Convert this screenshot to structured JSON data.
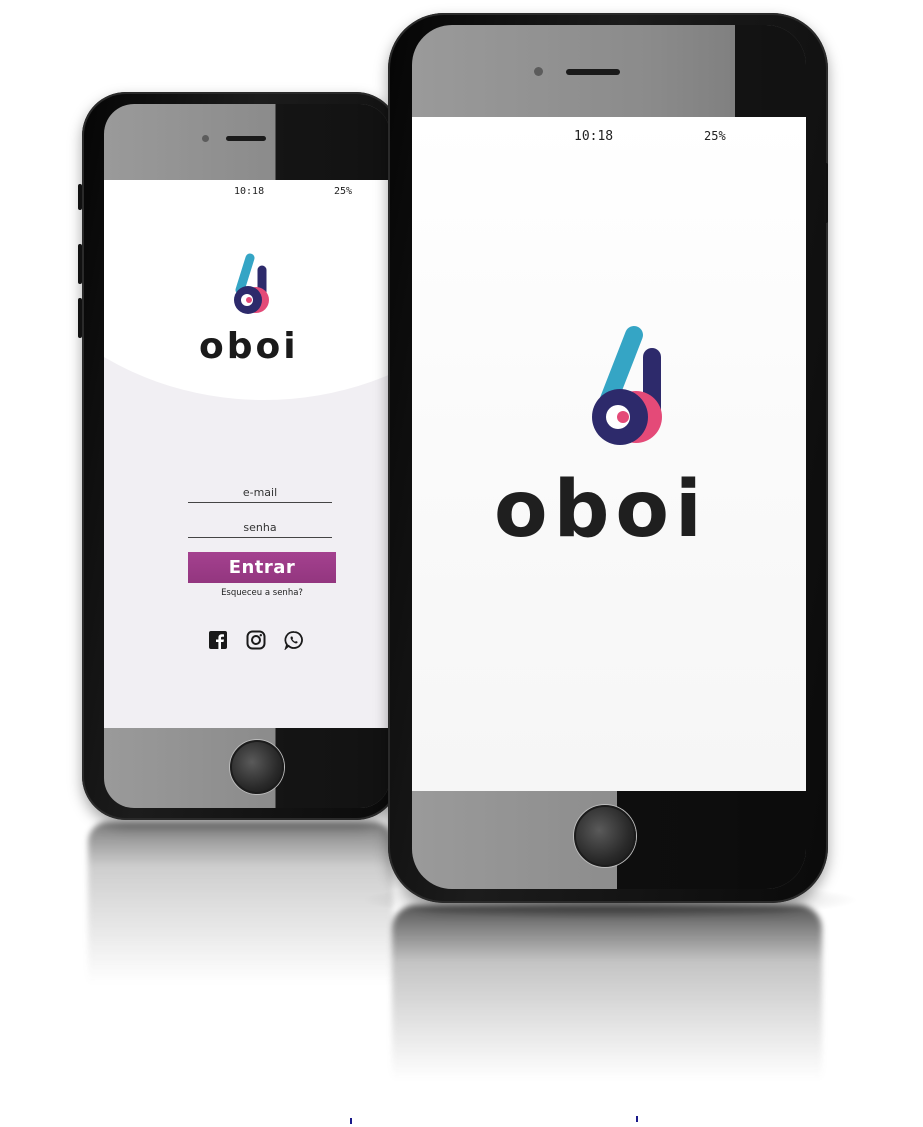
{
  "mockup": {
    "brand_name": "oboi"
  },
  "back_phone": {
    "status": {
      "time": "10:18",
      "battery": "25%"
    },
    "login": {
      "brand": "oboi",
      "email_placeholder": "e-mail",
      "password_placeholder": "senha",
      "submit_label": "Entrar",
      "forgot_label": "Esqueceu a senha?",
      "social_icons": [
        "facebook-icon",
        "instagram-icon",
        "whatsapp-icon"
      ]
    }
  },
  "front_phone": {
    "status": {
      "time": "10:18",
      "battery": "25%"
    },
    "splash": {
      "brand": "oboi"
    }
  },
  "colors": {
    "accent": "#a4418f",
    "logo_blue": "#35a5c5",
    "logo_navy": "#2d2a6b",
    "logo_pink": "#e44a78",
    "logo_text": "#1a1a1a"
  }
}
